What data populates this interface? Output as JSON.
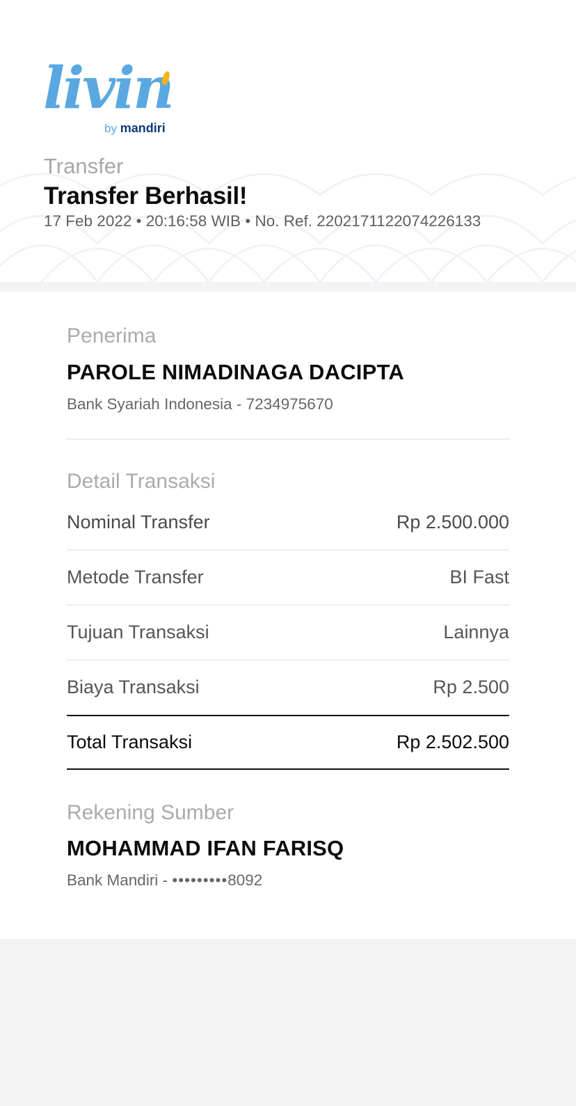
{
  "header": {
    "logo": {
      "wordmark": "livin",
      "by": "by",
      "brand": "mandiri"
    },
    "subtitle": "Transfer",
    "title": "Transfer Berhasil!",
    "meta": "17 Feb 2022 • 20:16:58 WIB • No. Ref. 2202171122074226133"
  },
  "recipient": {
    "label": "Penerima",
    "name": "PAROLE NIMADINAGA DACIPTA",
    "bank": "Bank Syariah Indonesia - 7234975670"
  },
  "details": {
    "label": "Detail Transaksi",
    "rows": [
      {
        "key": "Nominal Transfer",
        "value": "Rp 2.500.000"
      },
      {
        "key": "Metode Transfer",
        "value": "BI Fast"
      },
      {
        "key": "Tujuan Transaksi",
        "value": "Lainnya"
      },
      {
        "key": "Biaya Transaksi",
        "value": "Rp 2.500"
      }
    ],
    "total": {
      "key": "Total Transaksi",
      "value": "Rp 2.502.500"
    }
  },
  "source": {
    "label": "Rekening Sumber",
    "name": "MOHAMMAD IFAN FARISQ",
    "bank_prefix": "Bank Mandiri - ",
    "masked_dots": "•••••••••",
    "account_suffix": "8092"
  },
  "colors": {
    "logo_blue": "#5aa8e1",
    "logo_navy": "#0f3b79",
    "logo_accent": "#f5b21c",
    "page_bg": "#f4f3f4"
  }
}
